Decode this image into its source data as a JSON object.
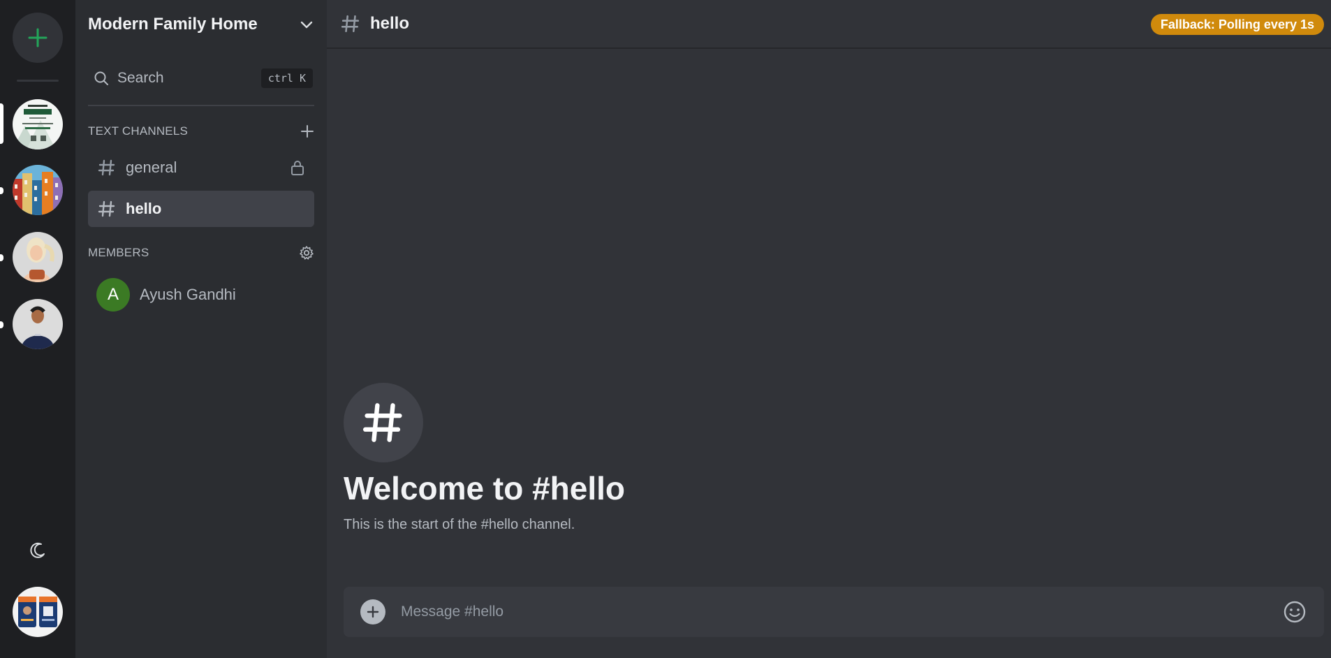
{
  "rail": {
    "add_server_icon": "plus-icon",
    "servers": [
      {
        "name": "Certificate of Participation server",
        "avatar": "certificate-image",
        "active": true
      },
      {
        "name": "Colorful houses server",
        "avatar": "houses-image",
        "active": false
      },
      {
        "name": "Portrait server",
        "avatar": "woman-portrait-image",
        "active": false
      },
      {
        "name": "Man portrait server",
        "avatar": "man-portrait-image",
        "active": false
      }
    ],
    "theme_icon": "moon-icon",
    "user_avatar": "profile-cards-image"
  },
  "sidebar": {
    "server_name": "Modern Family Home",
    "search_label": "Search",
    "search_shortcut": "ctrl K",
    "text_channels_title": "TEXT CHANNELS",
    "channels": [
      {
        "name": "general",
        "locked": true,
        "active": false
      },
      {
        "name": "hello",
        "locked": false,
        "active": true
      }
    ],
    "members_title": "MEMBERS",
    "members": [
      {
        "initial": "A",
        "name": "Ayush Gandhi",
        "avatar_color": "#3b7a24"
      }
    ]
  },
  "main": {
    "channel_name": "hello",
    "status_badge": "Fallback: Polling every 1s",
    "welcome_title": "Welcome to #hello",
    "welcome_subtitle": "This is the start of the #hello channel.",
    "composer_placeholder": "Message #hello"
  },
  "colors": {
    "accent_green": "#23a55a",
    "status_badge": "#d08a0c",
    "rail_bg": "#1e1f22",
    "sidebar_bg": "#2b2d31",
    "main_bg": "#313338"
  }
}
